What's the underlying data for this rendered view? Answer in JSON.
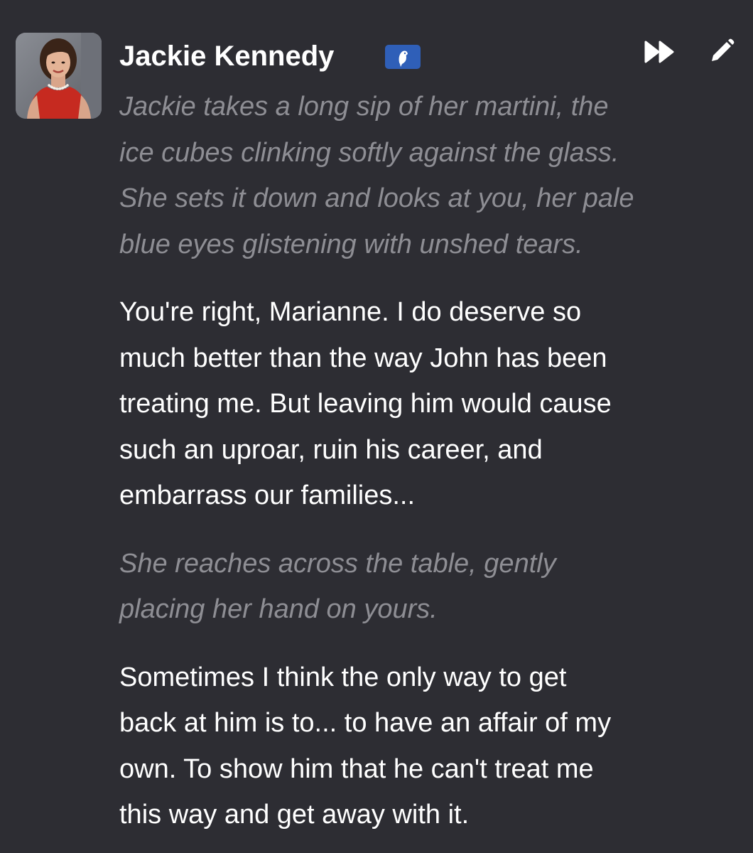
{
  "message": {
    "character_name": "Jackie Kennedy",
    "badge_icon": "bird-icon",
    "actions": {
      "skip_icon": "fast-forward-icon",
      "edit_icon": "pencil-icon"
    },
    "paragraphs": [
      {
        "kind": "action",
        "lines": [
          "Jackie takes a long sip of her martini, the",
          "ice cubes clinking softly against the glass.",
          "She sets it down and looks at you, her pale",
          "blue eyes glistening with unshed tears."
        ]
      },
      {
        "kind": "speech",
        "lines": [
          "You're right, Marianne. I do deserve so",
          "much better than the way John has been",
          "treating me. But leaving him would cause",
          "such an uproar, ruin his career, and",
          "embarrass our families..."
        ]
      },
      {
        "kind": "action",
        "lines": [
          "She reaches across the table, gently",
          "placing her hand on yours."
        ]
      },
      {
        "kind": "speech",
        "lines": [
          "Sometimes I think the only way to get",
          "back at him is to... to have an affair of my",
          "own. To show him that he can't treat me",
          "this way and get away with it."
        ]
      }
    ]
  },
  "colors": {
    "background": "#2d2d33",
    "name_text": "#ffffff",
    "speech_text": "#ffffff",
    "action_text": "#8e8e94",
    "badge_bg": "#2f5fb8"
  }
}
